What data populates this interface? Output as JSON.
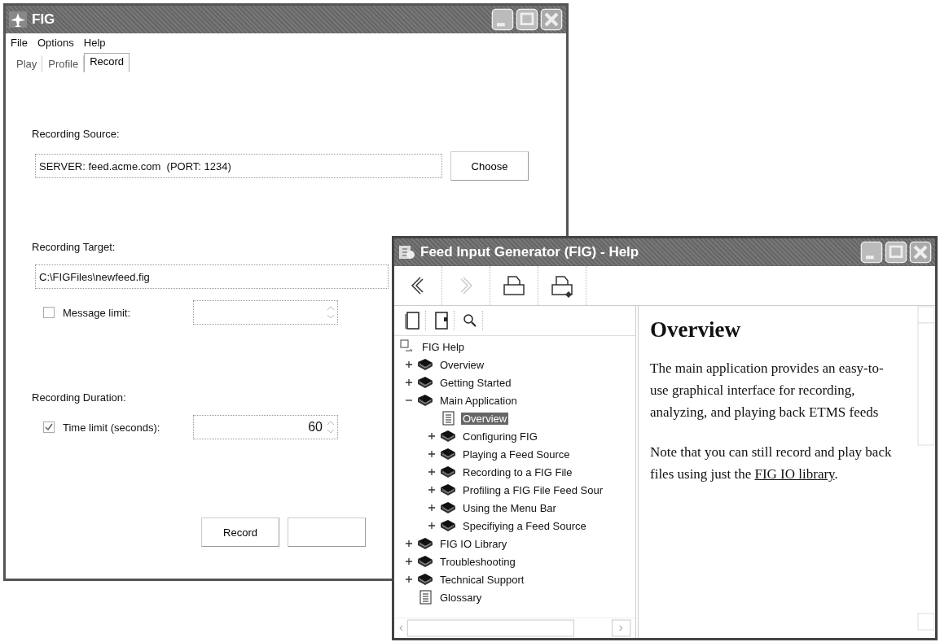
{
  "main_window": {
    "title": "FIG",
    "menu": [
      "File",
      "Options",
      "Help"
    ],
    "tabs": [
      {
        "label": "Play",
        "selected": false
      },
      {
        "label": "Profile",
        "selected": false
      },
      {
        "label": "Record",
        "selected": true
      }
    ],
    "source": {
      "label": "Recording Source:",
      "value": "SERVER: feed.acme.com  (PORT: 1234)",
      "button": "Choose"
    },
    "target": {
      "label": "Recording Target:",
      "value": "C:\\FIGFiles\\newfeed.fig",
      "message_limit": {
        "label": "Message limit:",
        "checked": false
      }
    },
    "duration": {
      "label": "Recording Duration:",
      "time_limit": {
        "label": "Time limit (seconds):",
        "checked": true,
        "value": "60"
      }
    },
    "buttons": [
      "Record"
    ]
  },
  "help_window": {
    "title": "Feed Input Generator (FIG) - Help",
    "toolbar": [
      {
        "kind": "back",
        "disabled": false
      },
      {
        "kind": "forward",
        "disabled": true
      },
      {
        "kind": "print",
        "disabled": false
      },
      {
        "kind": "options",
        "disabled": false
      }
    ],
    "tree_tabs": [
      {
        "kind": "contents"
      },
      {
        "kind": "index"
      },
      {
        "kind": "search"
      }
    ],
    "tree": {
      "label": "FIG Help",
      "children": [
        {
          "kind": "book",
          "label": "Overview",
          "expanded": false
        },
        {
          "kind": "book",
          "label": "Getting Started",
          "expanded": false
        },
        {
          "kind": "book",
          "label": "Main Application",
          "expanded": true,
          "children": [
            {
              "kind": "page",
              "label": "Overview",
              "selected": true
            },
            {
              "kind": "book",
              "label": "Configuring FIG",
              "expanded": false
            },
            {
              "kind": "book",
              "label": "Playing a Feed Source",
              "expanded": false
            },
            {
              "kind": "book",
              "label": "Recording to a FIG File",
              "expanded": false
            },
            {
              "kind": "book",
              "label": "Profiling a FIG File Feed Sour",
              "expanded": false
            },
            {
              "kind": "book",
              "label": "Using the Menu Bar",
              "expanded": false
            },
            {
              "kind": "book",
              "label": "Specifiying a Feed Source",
              "expanded": false
            }
          ]
        },
        {
          "kind": "book",
          "label": "FIG IO Library",
          "expanded": false
        },
        {
          "kind": "book",
          "label": "Troubleshooting",
          "expanded": false
        },
        {
          "kind": "book",
          "label": "Technical Support",
          "expanded": false
        },
        {
          "kind": "page",
          "label": "Glossary",
          "selected": false
        }
      ]
    },
    "content": {
      "heading": "Overview",
      "paragraphs": [
        {
          "text": "The main application provides an easy-to-use graphical interface for recording, analyzing, and playing back ETMS feeds"
        },
        {
          "text": "Note that you can still record and play back files using just the ",
          "link": "FIG IO library",
          "after": "."
        }
      ]
    }
  }
}
